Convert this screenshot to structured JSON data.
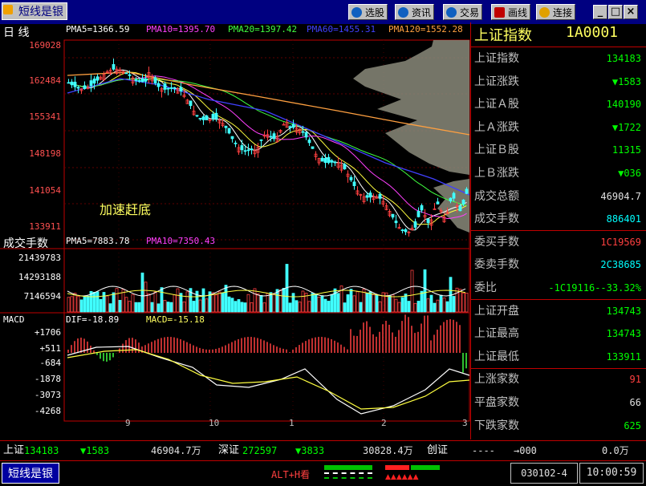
{
  "app": {
    "title": "短线是银"
  },
  "toolbar": {
    "buttons": [
      {
        "label": "选股",
        "color": "#1060c0"
      },
      {
        "label": "资讯",
        "color": "#1060c0"
      },
      {
        "label": "交易",
        "color": "#1060c0"
      },
      {
        "label": "画线",
        "color": "#c00000"
      },
      {
        "label": "连接",
        "color": "#e0a000"
      }
    ],
    "min": "_",
    "max": "□",
    "close": "×"
  },
  "main": {
    "period": "日  线",
    "ma": {
      "pma5": "PMA5=1366.59",
      "pma10": "PMA10=1395.70",
      "pma20": "PMA20=1397.42",
      "pma60": "PMA60=1455.31",
      "pma120": "PMA120=1552.28"
    },
    "price_ticks": [
      "169028",
      "162484",
      "155341",
      "148198",
      "141054",
      "133911"
    ],
    "annotation": "加速赶底",
    "vol_title": "成交手数",
    "vol_ma": {
      "pma5": "PMA5=7883.78",
      "pma10": "PMA10=7350.43"
    },
    "vol_ticks": [
      "21439783",
      "14293188",
      "7146594"
    ],
    "macd_title": "MACD",
    "macd_vals": {
      "dif": "DIF=-18.89",
      "macd": "MACD=-15.18"
    },
    "macd_ticks": [
      "+1706",
      "+511",
      "-684",
      "-1878",
      "-3073",
      "-4268"
    ],
    "x_ticks": [
      "9",
      "10",
      "1",
      "2",
      "3"
    ]
  },
  "panel": {
    "name": "上证指数",
    "code": "1A0001",
    "rows": [
      {
        "label": "上证指数",
        "value": "134183",
        "color": "#00ff00"
      },
      {
        "label": "上证涨跌",
        "value": "▼1583",
        "color": "#00ff00"
      },
      {
        "label": "上证Ａ股",
        "value": "140190",
        "color": "#00ff00"
      },
      {
        "label": "上Ａ涨跌",
        "value": "▼1722",
        "color": "#00ff00"
      },
      {
        "label": "上证Ｂ股",
        "value": "11315",
        "color": "#00ff00"
      },
      {
        "label": "上Ｂ涨跌",
        "value": "▼036",
        "color": "#00ff00"
      },
      {
        "label": "成交总额",
        "value": "46904.7",
        "color": "#e0e0e0"
      },
      {
        "label": "成交手数",
        "value": "886401",
        "color": "#00ffff"
      },
      {
        "label": "委买手数",
        "value": "1C19569",
        "color": "#ff4040"
      },
      {
        "label": "委卖手数",
        "value": "2C38685",
        "color": "#00ffff"
      },
      {
        "label": "委比",
        "value": "-1C19116--33.32%",
        "color": "#00ff00"
      },
      {
        "label": "上证开盘",
        "value": "134743",
        "color": "#00ff00"
      },
      {
        "label": "上证最高",
        "value": "134743",
        "color": "#00ff00"
      },
      {
        "label": "上证最低",
        "value": "133911",
        "color": "#00ff00"
      },
      {
        "label": "上涨家数",
        "value": "91",
        "color": "#ff4040"
      },
      {
        "label": "平盘家数",
        "value": "66",
        "color": "#e0e0e0"
      },
      {
        "label": "下跌家数",
        "value": "625",
        "color": "#00ff00"
      }
    ]
  },
  "status": {
    "sh_label": "上证",
    "sh_val": "134183",
    "sh_chg": "▼1583",
    "sh_amt": "46904.7万",
    "sz_label": "深证",
    "sz_val": "272597",
    "sz_chg": "▼3833",
    "sz_amt": "30828.4万",
    "cy_label": "创证",
    "cy_val": "----",
    "arrow": "→000",
    "amt2": "0.0万"
  },
  "taskbar": {
    "app": "短线是银",
    "hint": "ALT+H看",
    "code": "030102-4",
    "time": "10:00:59"
  }
}
